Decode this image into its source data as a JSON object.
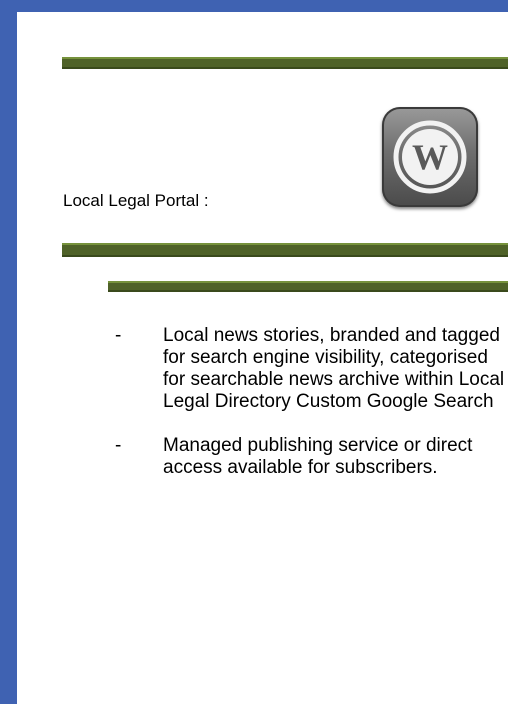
{
  "portal": {
    "label": "Local Legal Portal :"
  },
  "logo": {
    "icon": "wordpress-icon",
    "text": "W"
  },
  "bullets": [
    {
      "dash": "-",
      "text": "Local news stories, branded and tagged for search engine visibility, categorised for searchable news archive within Local Legal Directory Custom Google Search"
    },
    {
      "dash": "-",
      "text": "Managed publishing service or direct access available for subscribers."
    }
  ],
  "colors": {
    "border_blue": "#3f62b2",
    "rule_green": "#4f6228",
    "text": "#000000"
  }
}
